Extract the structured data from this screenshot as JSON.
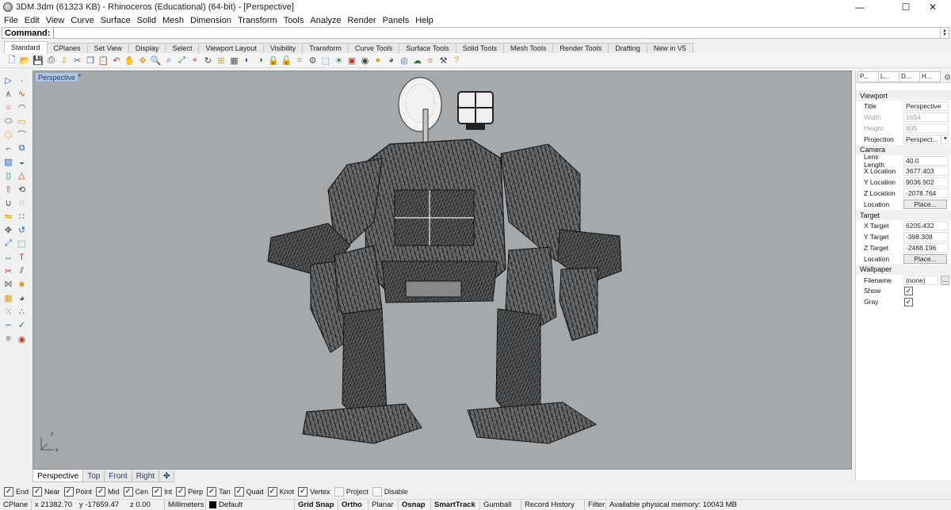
{
  "window": {
    "title": "3DM.3dm (61323 KB) - Rhinoceros (Educational) (64-bit) - [Perspective]",
    "controls": {
      "minimize": "—",
      "maximize": "☐",
      "close": "✕"
    }
  },
  "menu": [
    "File",
    "Edit",
    "View",
    "Curve",
    "Surface",
    "Solid",
    "Mesh",
    "Dimension",
    "Transform",
    "Tools",
    "Analyze",
    "Render",
    "Panels",
    "Help"
  ],
  "command": {
    "label": "Command:",
    "value": ""
  },
  "toolbar_tabs": [
    "Standard",
    "CPlanes",
    "Set View",
    "Display",
    "Select",
    "Viewport Layout",
    "Visibility",
    "Transform",
    "Curve Tools",
    "Surface Tools",
    "Solid Tools",
    "Mesh Tools",
    "Render Tools",
    "Drafting",
    "New in V5"
  ],
  "toolbar_icons": [
    "new-file",
    "open-file",
    "save-file",
    "print",
    "import",
    "cut",
    "copy",
    "paste",
    "undo",
    "pan",
    "move-view",
    "zoom-dynamic",
    "zoom-window",
    "zoom-extents",
    "zoom-selected",
    "rotate-view",
    "four-viewports",
    "wireframe",
    "hide-objects",
    "show-objects",
    "lock-objects",
    "unlock-objects",
    "layers",
    "properties",
    "select-all",
    "lights",
    "snapshots",
    "materials",
    "shaded",
    "rendered",
    "render-preview",
    "environment",
    "sun",
    "options",
    "help"
  ],
  "left_toolbar_icons": [
    "select-arrow",
    "point",
    "polyline",
    "curve",
    "circle",
    "arc",
    "ellipse",
    "rectangle",
    "polygon",
    "free-curve",
    "fillet",
    "offset",
    "box",
    "sphere",
    "cylinder",
    "cone",
    "extrude",
    "revolve",
    "boolean-union",
    "boolean-split",
    "mirror",
    "array",
    "move",
    "rotate",
    "scale",
    "group",
    "dimension",
    "text",
    "trim",
    "split",
    "join",
    "explode",
    "mesh",
    "render-shape",
    "grid",
    "points-on",
    "curve-tools",
    "checkmark",
    "layer",
    "material"
  ],
  "viewport": {
    "label": "Perspective",
    "dropdown": "▾",
    "axis_x": "x",
    "axis_z": "z"
  },
  "viewport_tabs": [
    "Perspective",
    "Top",
    "Front",
    "Right",
    "✤"
  ],
  "panel": {
    "tabs": [
      "P...",
      "L...",
      "D...",
      "H..."
    ],
    "gear": "⚙",
    "sections": {
      "viewport": {
        "heading": "Viewport",
        "title_label": "Title",
        "title_value": "Perspective",
        "width_label": "Width",
        "width_value": "1654",
        "height_label": "Height",
        "height_value": "805",
        "projection_label": "Projection",
        "projection_value": "Perspect..."
      },
      "camera": {
        "heading": "Camera",
        "lens_label": "Lens Length",
        "lens_value": "40.0",
        "x_label": "X Location",
        "x_value": "3677.403",
        "y_label": "Y Location",
        "y_value": "9036.902",
        "z_label": "Z Location",
        "z_value": "-2078.764",
        "loc_label": "Location",
        "loc_button": "Place..."
      },
      "target": {
        "heading": "Target",
        "x_label": "X Target",
        "x_value": "6205.432",
        "y_label": "Y Target",
        "y_value": "-398.308",
        "z_label": "Z Target",
        "z_value": "-2488.196",
        "loc_label": "Location",
        "loc_button": "Place..."
      },
      "wallpaper": {
        "heading": "Wallpaper",
        "filename_label": "Filename",
        "filename_value": "(none)",
        "filename_button": "...",
        "show_label": "Show",
        "show_checked": "✓",
        "gray_label": "Gray",
        "gray_checked": "✓"
      }
    }
  },
  "osnaps": [
    {
      "label": "End",
      "check": "✓"
    },
    {
      "label": "Near",
      "check": "✓"
    },
    {
      "label": "Point",
      "check": "✓"
    },
    {
      "label": "Mid",
      "check": "✓"
    },
    {
      "label": "Cen",
      "check": "✓"
    },
    {
      "label": "Int",
      "check": "✓"
    },
    {
      "label": "Perp",
      "check": "✓"
    },
    {
      "label": "Tan",
      "check": "✓"
    },
    {
      "label": "Quad",
      "check": "✓"
    },
    {
      "label": "Knot",
      "check": "✓"
    },
    {
      "label": "Vertex",
      "check": "✓"
    },
    {
      "label": "Project",
      "check": ""
    },
    {
      "label": "Disable",
      "check": ""
    }
  ],
  "status": {
    "cplane": "CPlane",
    "x": "x 21382.70",
    "y": "y -17659.47",
    "z": "z 0.00",
    "units": "Millimeters",
    "layer": "Default",
    "grid_snap": "Grid Snap",
    "ortho": "Ortho",
    "planar": "Planar",
    "osnap": "Osnap",
    "smarttrack": "SmartTrack",
    "gumball": "Gumball",
    "record_history": "Record History",
    "filter": "Filter",
    "memory": "Available physical memory: 10043 MB"
  },
  "colors": {
    "viewport_bg": "#a4a9ae",
    "active_label": "#b3c5dd",
    "model_wire": "#1c1c1c"
  }
}
